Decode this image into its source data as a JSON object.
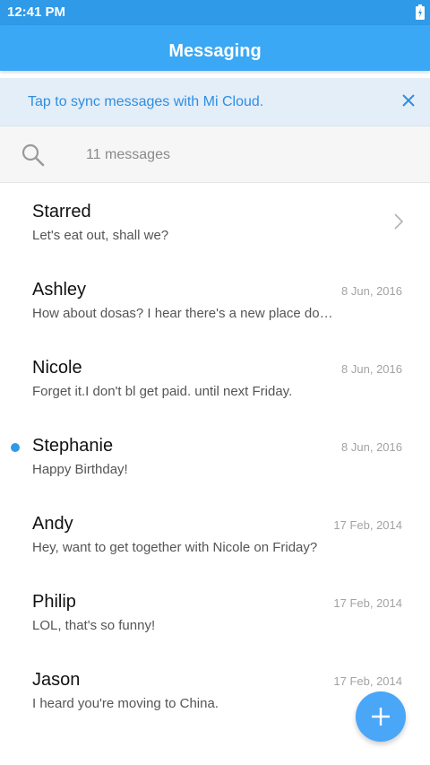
{
  "status_bar": {
    "time": "12:41 PM",
    "battery_icon": "battery-charging-icon"
  },
  "app_bar": {
    "title": "Messaging"
  },
  "sync_banner": {
    "text": "Tap to sync messages with Mi Cloud.",
    "close_icon": "close-icon"
  },
  "search": {
    "icon": "search-icon",
    "text": "11 messages"
  },
  "conversations": [
    {
      "name": "Starred",
      "snippet": "Let's eat out, shall we?",
      "date": "",
      "chevron": true
    },
    {
      "name": "Ashley",
      "snippet": "How about dosas? I hear there's a new place do…",
      "date": "8 Jun, 2016"
    },
    {
      "name": "Nicole",
      "snippet": "Forget it.I don't bl get paid. until next Friday.",
      "date": "8 Jun, 2016"
    },
    {
      "name": "Stephanie",
      "snippet": "Happy Birthday!",
      "date": "8 Jun, 2016",
      "unread": true
    },
    {
      "name": "Andy",
      "snippet": "Hey, want to get together with Nicole on Friday?",
      "date": "17 Feb, 2014"
    },
    {
      "name": "Philip",
      "snippet": "LOL, that's so funny!",
      "date": "17 Feb, 2014"
    },
    {
      "name": "Jason",
      "snippet": "I heard you're moving to China.",
      "date": "17 Feb, 2014"
    }
  ],
  "fab": {
    "icon": "plus-icon"
  },
  "colors": {
    "primary": "#3aa8f4",
    "status_bar": "#2f9ae8",
    "banner_bg": "#e3eef9",
    "link_text": "#2f8ee0",
    "unread_dot": "#2f9ae8"
  }
}
